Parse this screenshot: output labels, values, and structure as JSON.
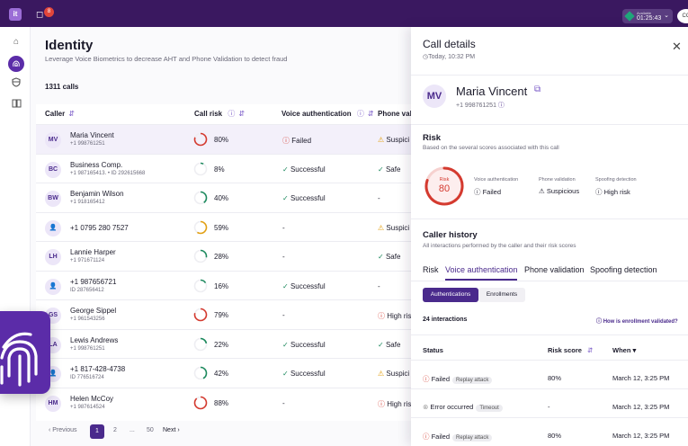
{
  "topbar": {
    "logo": "it",
    "notif_count": "8",
    "status_label": "Available",
    "status_time": "01:25:43",
    "user_initials": "CO"
  },
  "page": {
    "title": "Identity",
    "subtitle": "Leverage Voice Biometrics to decrease AHT and Phone Validation to detect fraud",
    "calls_count": "1311 calls"
  },
  "table": {
    "headers": {
      "caller": "Caller",
      "risk": "Call risk",
      "voice": "Voice authentication",
      "phone": "Phone valid"
    },
    "rows": [
      {
        "initials": "MV",
        "name": "Maria Vincent",
        "phone": "+1 998761251",
        "risk": "80%",
        "risk_val": 80,
        "voice": "Failed",
        "phone_val": "Suspici"
      },
      {
        "initials": "BC",
        "name": "Business Comp.",
        "phone": "+1 987165413. • ID 292615668",
        "risk": "8%",
        "risk_val": 8,
        "voice": "Successful",
        "phone_val": "Safe"
      },
      {
        "initials": "BW",
        "name": "Benjamin Wilson",
        "phone": "+1 918165412",
        "risk": "40%",
        "risk_val": 40,
        "voice": "Successful",
        "phone_val": "-"
      },
      {
        "initials": "",
        "name": "+1 0795 280 7527",
        "phone": "",
        "risk": "59%",
        "risk_val": 59,
        "voice": "-",
        "phone_val": "Suspici"
      },
      {
        "initials": "LH",
        "name": "Lannie Harper",
        "phone": "+1 971671124",
        "risk": "28%",
        "risk_val": 28,
        "voice": "-",
        "phone_val": "Safe"
      },
      {
        "initials": "",
        "name": "+1 987656721",
        "phone": "ID 287656412",
        "risk": "16%",
        "risk_val": 16,
        "voice": "Successful",
        "phone_val": "-"
      },
      {
        "initials": "GS",
        "name": "George Sippel",
        "phone": "+1 961543256",
        "risk": "79%",
        "risk_val": 79,
        "voice": "-",
        "phone_val": "High ris"
      },
      {
        "initials": "LA",
        "name": "Lewis Andrews",
        "phone": "+1 998761251",
        "risk": "22%",
        "risk_val": 22,
        "voice": "Successful",
        "phone_val": "Safe"
      },
      {
        "initials": "",
        "name": "+1 817-428-4738",
        "phone": "ID 776516724",
        "risk": "42%",
        "risk_val": 42,
        "voice": "Successful",
        "phone_val": "Suspici"
      },
      {
        "initials": "HM",
        "name": "Helen McCoy",
        "phone": "+1 987614524",
        "risk": "88%",
        "risk_val": 88,
        "voice": "-",
        "phone_val": "High ris"
      }
    ]
  },
  "pager": {
    "prev": "Previous",
    "p1": "1",
    "p2": "2",
    "dots": "...",
    "last": "50",
    "next": "Next"
  },
  "panel": {
    "title": "Call details",
    "time": "Today, 10:32 PM",
    "initials": "MV",
    "name": "Maria Vincent",
    "phone": "+1 998761251",
    "risk_title": "Risk",
    "risk_sub": "Based on the several scores associated with this call",
    "risk_label": "Risk",
    "risk_value": "80",
    "voice_label": "Voice authentication",
    "voice_value": "Failed",
    "phone_label": "Phone validation",
    "phone_value": "Suspicious",
    "spoof_label": "Spoofing detection",
    "spoof_value": "High risk",
    "history_title": "Caller history",
    "history_sub": "All interactions performed by the caller and their risk scores",
    "tabs": [
      "Risk",
      "Voice authentication",
      "Phone validation",
      "Spoofing detection"
    ],
    "seg_on": "Authentications",
    "seg_off": "Enrollments",
    "interactions": "24 interactions",
    "help": "How is enrollment validated?",
    "col_status": "Status",
    "col_score": "Risk score",
    "col_when": "When",
    "history": [
      {
        "status": "Failed",
        "tag": "Replay attack",
        "score": "80%",
        "when": "March 12, 3:25 PM"
      },
      {
        "status": "Error occurred",
        "tag": "Timeout",
        "score": "-",
        "when": "March 12, 3:25 PM"
      },
      {
        "status": "Failed",
        "tag": "Replay attack",
        "score": "80%",
        "when": "March 12, 3:25 PM"
      }
    ]
  },
  "colors": {
    "brand": "#3a1860",
    "accent": "#4a2a8c",
    "danger": "#d43a2f",
    "warning": "#e2a012",
    "success": "#1d8a5e"
  }
}
